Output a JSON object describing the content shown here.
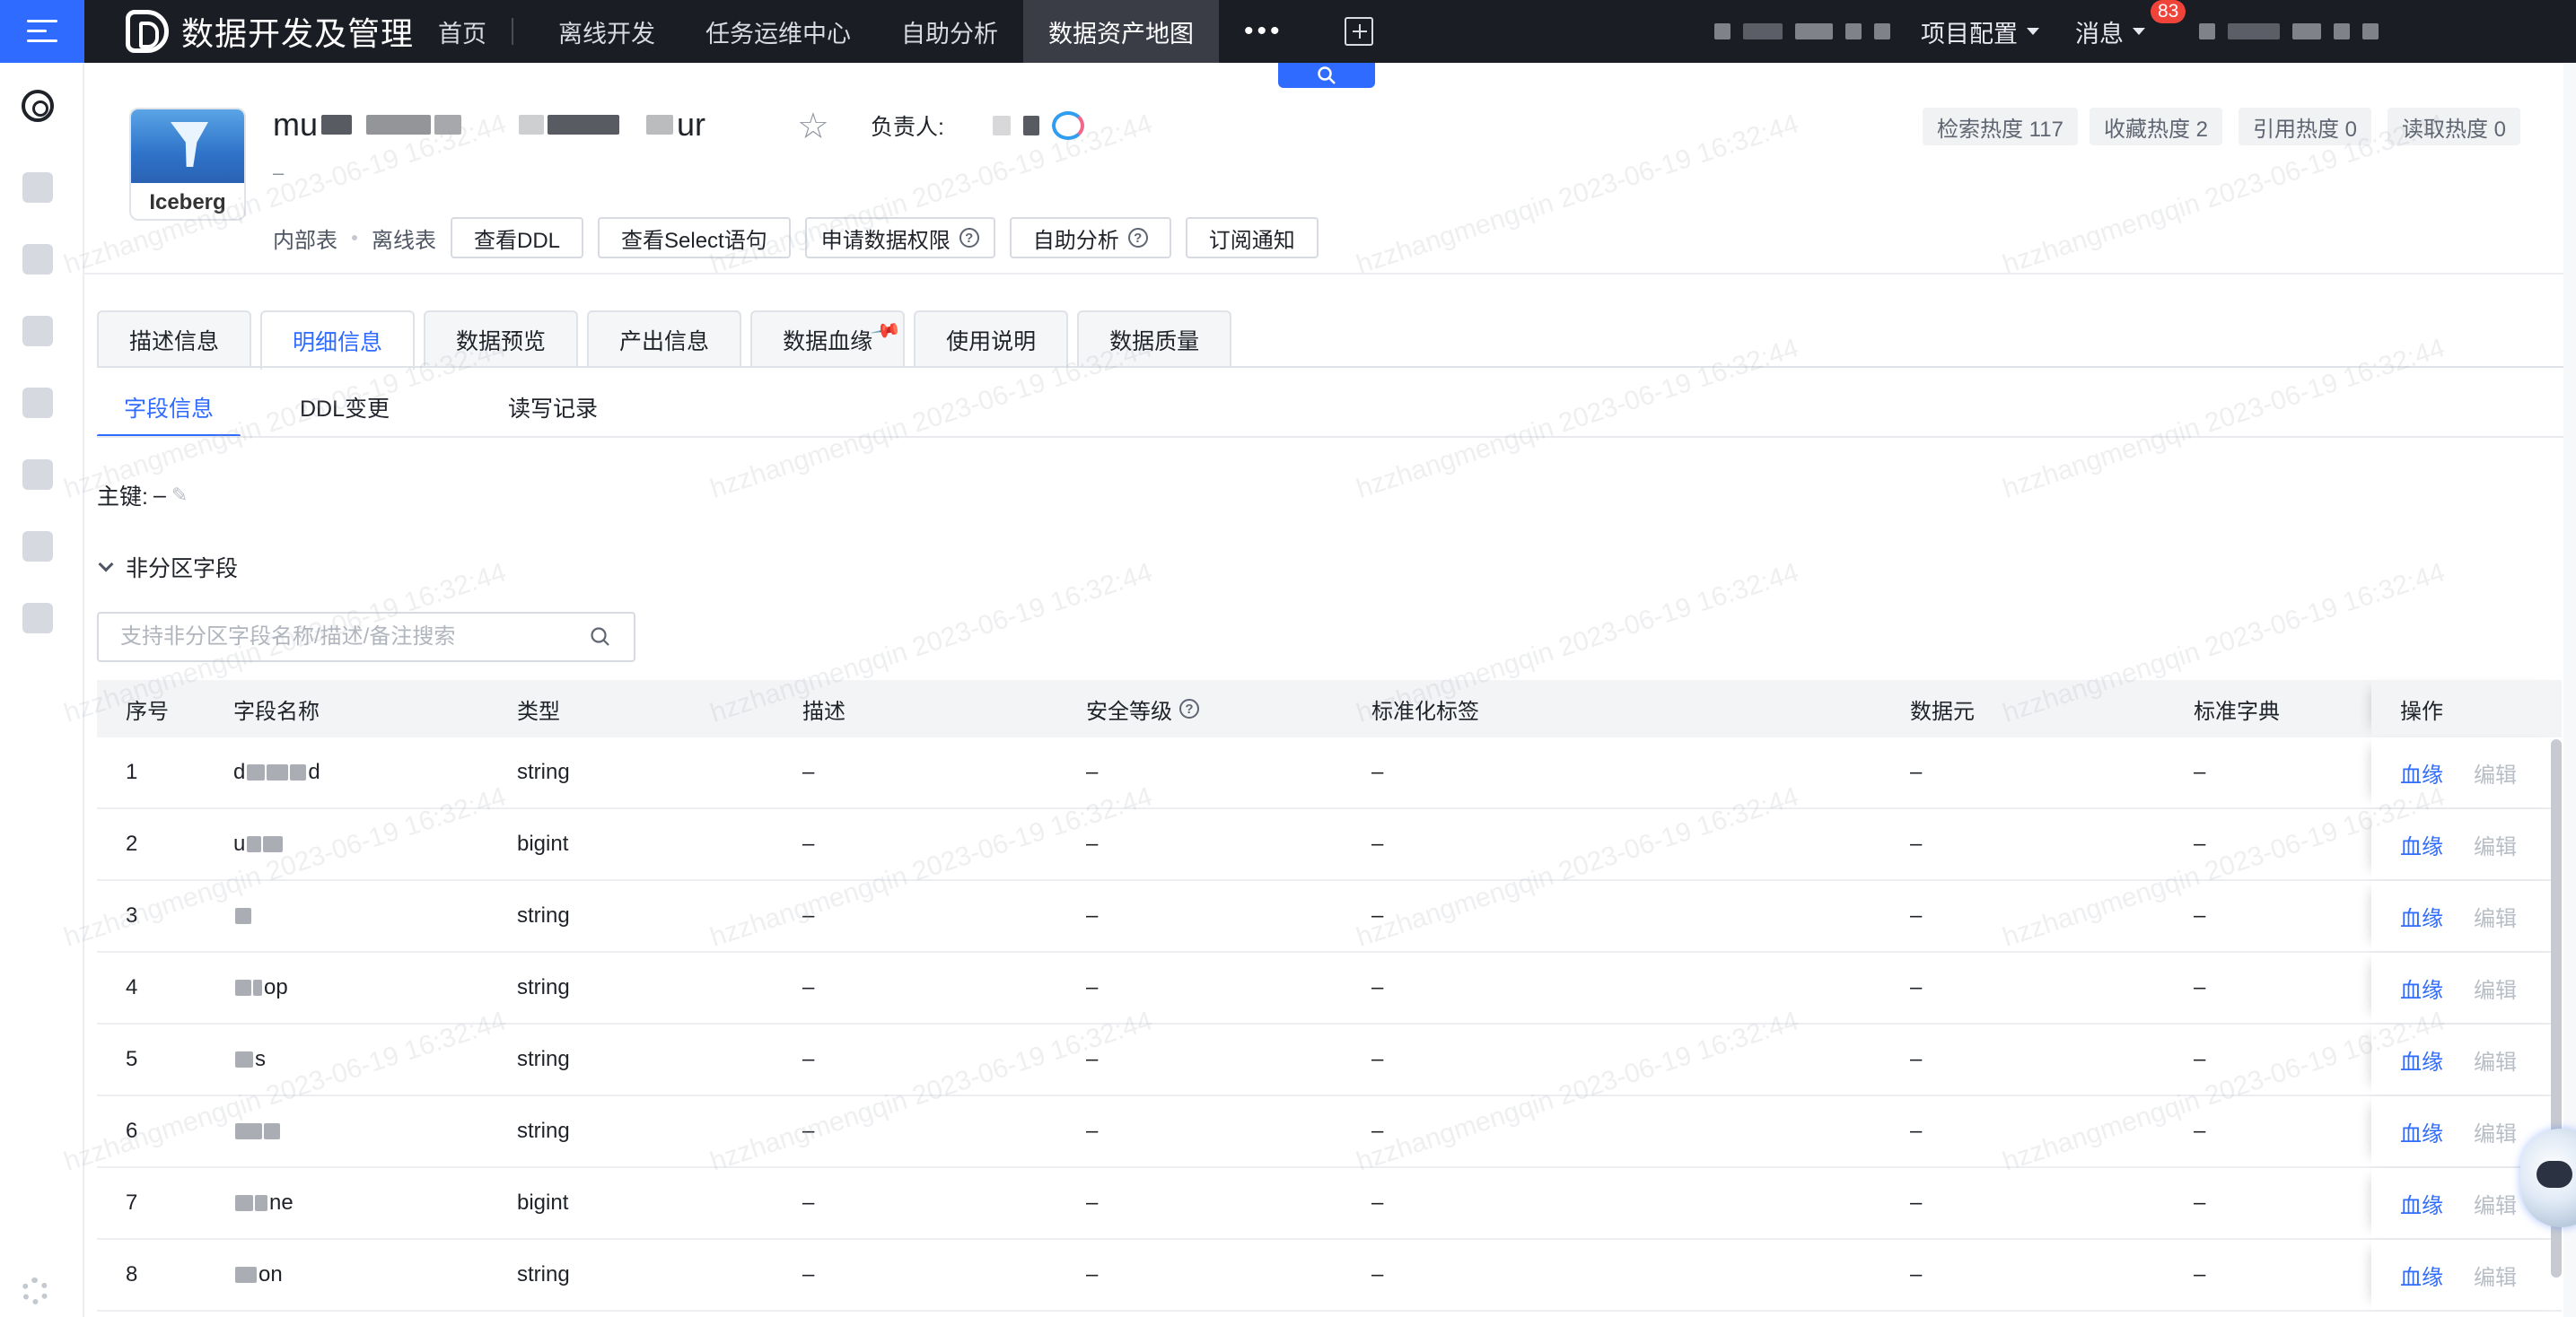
{
  "topbar": {
    "app_title": "数据开发及管理",
    "nav": [
      "首页",
      "离线开发",
      "任务运维中心",
      "自助分析",
      "数据资产地图"
    ],
    "active_nav": "数据资产地图",
    "more": "•••",
    "project_config": "项目配置",
    "messages": "消息",
    "message_count": "83",
    "accent": "#2f6bff"
  },
  "header": {
    "table_name_prefix": "mu",
    "table_name_suffix": "ur",
    "table_format": "Iceberg",
    "description": "–",
    "owner_label": "负责人:",
    "heat": [
      "检索热度 117",
      "收藏热度 2",
      "引用热度 0",
      "读取热度 0"
    ],
    "table_type": "内部表",
    "table_kind": "离线表",
    "buttons": [
      "查看DDL",
      "查看Select语句",
      "申请数据权限",
      "自助分析",
      "订阅通知"
    ]
  },
  "tabs": {
    "items": [
      "描述信息",
      "明细信息",
      "数据预览",
      "产出信息",
      "数据血缘",
      "使用说明",
      "数据质量"
    ],
    "active": "明细信息"
  },
  "subtabs": {
    "items": [
      "字段信息",
      "DDL变更",
      "读写记录"
    ],
    "active": "字段信息"
  },
  "primary_key": {
    "label": "主键:",
    "value": "–"
  },
  "section": {
    "title": "非分区字段"
  },
  "search": {
    "placeholder": "支持非分区字段名称/描述/备注搜索"
  },
  "table": {
    "headers": [
      "序号",
      "字段名称",
      "类型",
      "描述",
      "安全等级",
      "标准化标签",
      "数据元",
      "标准字典",
      "操作"
    ],
    "rows": [
      {
        "no": "1",
        "name_visible": "d",
        "name_tail": "d",
        "type": "string",
        "desc": "–",
        "security": "–",
        "tag": "–",
        "element": "–",
        "dict": "–"
      },
      {
        "no": "2",
        "name_visible": "u",
        "name_tail": "",
        "type": "bigint",
        "desc": "–",
        "security": "–",
        "tag": "–",
        "element": "–",
        "dict": "–"
      },
      {
        "no": "3",
        "name_visible": "",
        "name_tail": "",
        "type": "string",
        "desc": "–",
        "security": "–",
        "tag": "–",
        "element": "–",
        "dict": "–"
      },
      {
        "no": "4",
        "name_visible": "",
        "name_tail": "op",
        "type": "string",
        "desc": "–",
        "security": "–",
        "tag": "–",
        "element": "–",
        "dict": "–"
      },
      {
        "no": "5",
        "name_visible": "",
        "name_tail": "s",
        "type": "string",
        "desc": "–",
        "security": "–",
        "tag": "–",
        "element": "–",
        "dict": "–"
      },
      {
        "no": "6",
        "name_visible": "",
        "name_tail": "",
        "type": "string",
        "desc": "–",
        "security": "–",
        "tag": "–",
        "element": "–",
        "dict": "–"
      },
      {
        "no": "7",
        "name_visible": "",
        "name_tail": "ne",
        "type": "bigint",
        "desc": "–",
        "security": "–",
        "tag": "–",
        "element": "–",
        "dict": "–"
      },
      {
        "no": "8",
        "name_visible": "",
        "name_tail": "on",
        "type": "string",
        "desc": "–",
        "security": "–",
        "tag": "–",
        "element": "–",
        "dict": "–"
      }
    ],
    "action_lineage": "血缘",
    "action_edit": "编辑"
  },
  "watermark": "hzzhangmengqin 2023-06-19 16:32:44"
}
